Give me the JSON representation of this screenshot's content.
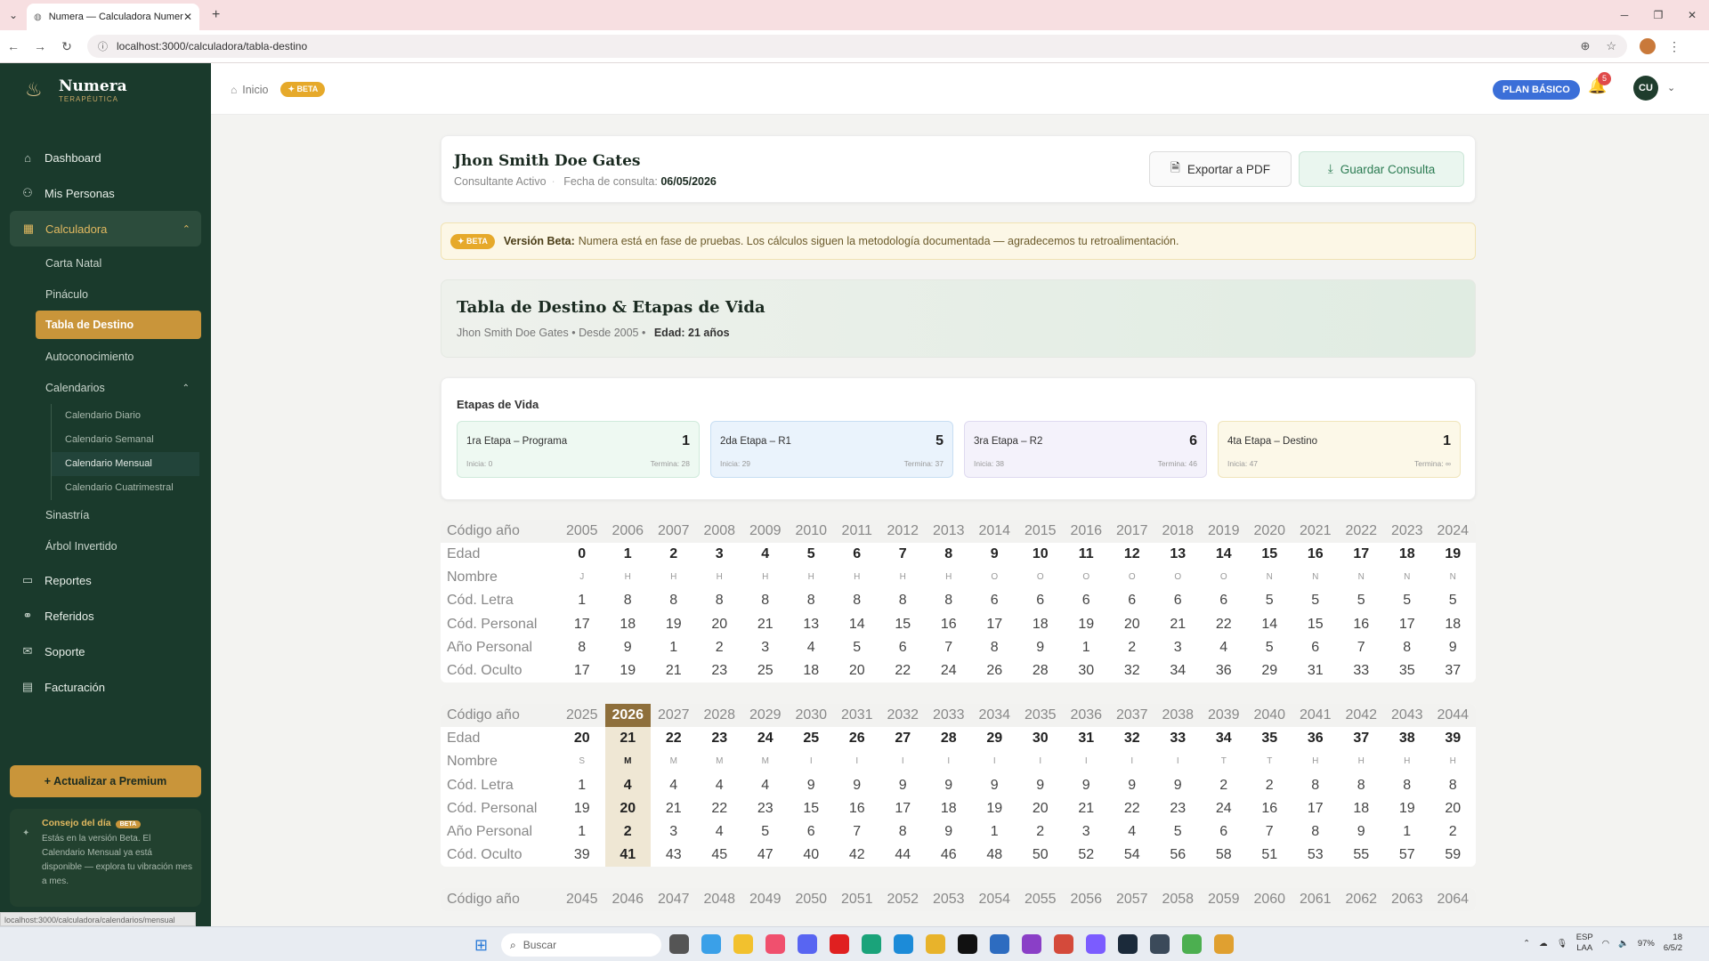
{
  "browser": {
    "tab_title": "Numera — Calculadora Numer",
    "url": "localhost:3000/calculadora/tabla-destino",
    "status_url": "localhost:3000/calculadora/calendarios/mensual"
  },
  "sidebar": {
    "brand": "Numera",
    "brand_sub": "TERAPÉUTICA",
    "items": [
      {
        "label": "Dashboard",
        "icon": "home-icon"
      },
      {
        "label": "Mis Personas",
        "icon": "users-icon"
      },
      {
        "label": "Calculadora",
        "icon": "calculator-icon"
      },
      {
        "label": "Reportes",
        "icon": "file-icon"
      },
      {
        "label": "Referidos",
        "icon": "share-icon"
      },
      {
        "label": "Soporte",
        "icon": "support-icon"
      },
      {
        "label": "Facturación",
        "icon": "billing-icon"
      }
    ],
    "calc_sub": [
      "Carta Natal",
      "Pináculo",
      "Tabla de Destino",
      "Autoconocimiento",
      "Calendarios",
      "Sinastría",
      "Árbol Invertido"
    ],
    "calendars": [
      "Calendario Diario",
      "Calendario Semanal",
      "Calendario Mensual",
      "Calendario Cuatrimestral"
    ],
    "upgrade": "+ Actualizar a Premium",
    "tip_title": "Consejo del día",
    "tip_badge": "BETA",
    "tip_text": "Estás en la versión Beta. El Calendario Mensual ya está disponible — explora tu vibración mes a mes."
  },
  "header": {
    "crumb": "Inicio",
    "beta": "✦ BETA",
    "plan": "PLAN BÁSICO",
    "notif_count": "5",
    "avatar": "CU"
  },
  "client": {
    "name": "Jhon Smith Doe Gates",
    "status": "Consultante Activo",
    "date_label": "Fecha de consulta:",
    "date": "06/05/2026",
    "export_btn": "Exportar a PDF",
    "save_btn": "Guardar Consulta"
  },
  "banner": {
    "badge": "✦ BETA",
    "title": "Versión Beta:",
    "text": "Numera está en fase de pruebas. Los cálculos siguen la metodología documentada — agradecemos tu retroalimentación."
  },
  "hero": {
    "title": "Tabla de Destino & Etapas de Vida",
    "name": "Jhon Smith Doe Gates",
    "since": "Desde 2005",
    "age": "Edad: 21 años"
  },
  "stages": {
    "title": "Etapas de Vida",
    "list": [
      {
        "label": "1ra Etapa – Programa",
        "num": "1",
        "start": "Inicia: 0",
        "end": "Termina: 28"
      },
      {
        "label": "2da Etapa – R1",
        "num": "5",
        "start": "Inicia: 29",
        "end": "Termina: 37"
      },
      {
        "label": "3ra Etapa – R2",
        "num": "6",
        "start": "Inicia: 38",
        "end": "Termina: 46"
      },
      {
        "label": "4ta Etapa – Destino",
        "num": "1",
        "start": "Inicia: 47",
        "end": "Termina: ∞"
      }
    ]
  },
  "table": {
    "row_labels": [
      "Edad",
      "Nombre",
      "Cód. Letra",
      "Cód. Personal",
      "Año Personal",
      "Cód. Oculto"
    ],
    "header_label": "Código año",
    "blocks": [
      {
        "years": [
          "2005",
          "2006",
          "2007",
          "2008",
          "2009",
          "2010",
          "2011",
          "2012",
          "2013",
          "2014",
          "2015",
          "2016",
          "2017",
          "2018",
          "2019",
          "2020",
          "2021",
          "2022",
          "2023",
          "2024"
        ],
        "rows": [
          [
            "0",
            "1",
            "2",
            "3",
            "4",
            "5",
            "6",
            "7",
            "8",
            "9",
            "10",
            "11",
            "12",
            "13",
            "14",
            "15",
            "16",
            "17",
            "18",
            "19"
          ],
          [
            "J",
            "H",
            "H",
            "H",
            "H",
            "H",
            "H",
            "H",
            "H",
            "O",
            "O",
            "O",
            "O",
            "O",
            "O",
            "N",
            "N",
            "N",
            "N",
            "N"
          ],
          [
            "1",
            "8",
            "8",
            "8",
            "8",
            "8",
            "8",
            "8",
            "8",
            "6",
            "6",
            "6",
            "6",
            "6",
            "6",
            "5",
            "5",
            "5",
            "5",
            "5"
          ],
          [
            "17",
            "18",
            "19",
            "20",
            "21",
            "13",
            "14",
            "15",
            "16",
            "17",
            "18",
            "19",
            "20",
            "21",
            "22",
            "14",
            "15",
            "16",
            "17",
            "18"
          ],
          [
            "8",
            "9",
            "1",
            "2",
            "3",
            "4",
            "5",
            "6",
            "7",
            "8",
            "9",
            "1",
            "2",
            "3",
            "4",
            "5",
            "6",
            "7",
            "8",
            "9"
          ],
          [
            "17",
            "19",
            "21",
            "23",
            "25",
            "18",
            "20",
            "22",
            "24",
            "26",
            "28",
            "30",
            "32",
            "34",
            "36",
            "29",
            "31",
            "33",
            "35",
            "37"
          ]
        ]
      },
      {
        "years": [
          "2025",
          "2026",
          "2027",
          "2028",
          "2029",
          "2030",
          "2031",
          "2032",
          "2033",
          "2034",
          "2035",
          "2036",
          "2037",
          "2038",
          "2039",
          "2040",
          "2041",
          "2042",
          "2043",
          "2044"
        ],
        "rows": [
          [
            "20",
            "21",
            "22",
            "23",
            "24",
            "25",
            "26",
            "27",
            "28",
            "29",
            "30",
            "31",
            "32",
            "33",
            "34",
            "35",
            "36",
            "37",
            "38",
            "39"
          ],
          [
            "S",
            "M",
            "M",
            "M",
            "M",
            "I",
            "I",
            "I",
            "I",
            "I",
            "I",
            "I",
            "I",
            "I",
            "T",
            "T",
            "H",
            "H",
            "H",
            "H"
          ],
          [
            "1",
            "4",
            "4",
            "4",
            "4",
            "9",
            "9",
            "9",
            "9",
            "9",
            "9",
            "9",
            "9",
            "9",
            "2",
            "2",
            "8",
            "8",
            "8",
            "8"
          ],
          [
            "19",
            "20",
            "21",
            "22",
            "23",
            "15",
            "16",
            "17",
            "18",
            "19",
            "20",
            "21",
            "22",
            "23",
            "24",
            "16",
            "17",
            "18",
            "19",
            "20"
          ],
          [
            "1",
            "2",
            "3",
            "4",
            "5",
            "6",
            "7",
            "8",
            "9",
            "1",
            "2",
            "3",
            "4",
            "5",
            "6",
            "7",
            "8",
            "9",
            "1",
            "2"
          ],
          [
            "39",
            "41",
            "43",
            "45",
            "47",
            "40",
            "42",
            "44",
            "46",
            "48",
            "50",
            "52",
            "54",
            "56",
            "58",
            "51",
            "53",
            "55",
            "57",
            "59"
          ]
        ]
      },
      {
        "years": [
          "2045",
          "2046",
          "2047",
          "2048",
          "2049",
          "2050",
          "2051",
          "2052",
          "2053",
          "2054",
          "2055",
          "2056",
          "2057",
          "2058",
          "2059",
          "2060",
          "2061",
          "2062",
          "2063",
          "2064"
        ],
        "rows": []
      }
    ]
  },
  "taskbar": {
    "search": "Buscar",
    "lang": "ESP\nLAA",
    "battery": "97%",
    "time": "18",
    "date": "6/5/2"
  }
}
